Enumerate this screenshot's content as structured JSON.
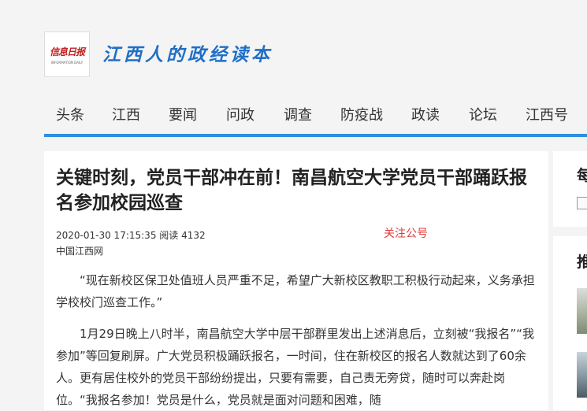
{
  "header": {
    "logo_text": "信息日报",
    "logo_subtext": "INFORMATION DAILY",
    "slogan": "江西人的政经读本"
  },
  "nav": {
    "items": [
      "头条",
      "江西",
      "要闻",
      "问政",
      "调查",
      "防疫战",
      "政读",
      "论坛",
      "江西号"
    ]
  },
  "article": {
    "title": "关键时刻，党员干部冲在前！南昌航空大学党员干部踊跃报名参加校园巡查",
    "datetime": "2020-01-30 17:15:35",
    "read_label": "阅读",
    "read_count": "4132",
    "follow_label": "关注公号",
    "source": "中国江西网",
    "paragraphs": [
      "“现在新校区保卫处值班人员严重不足，希望广大新校区教职工积极行动起来，义务承担学校校门巡查工作。”",
      "1月29日晚上八时半，南昌航空大学中层干部群里发出上述消息后，立刻被“我报名”“我参加”等回复刷屏。广大党员积极踊跃报名，一时间，住在新校区的报名人数就达到了60余人。更有居住校外的党员干部纷纷提出，只要有需要，自己责无旁贷，随时可以奔赴岗位。“我报名参加！党员是什么，党员就是面对问题和困难，随"
    ]
  },
  "sidebar": {
    "box1_heading": "每",
    "box2_heading": "推"
  },
  "colors": {
    "accent": "#2d8ee0",
    "slogan": "#1f6fc6",
    "logo_red": "#c4201f",
    "follow_red": "#e03a3a"
  }
}
